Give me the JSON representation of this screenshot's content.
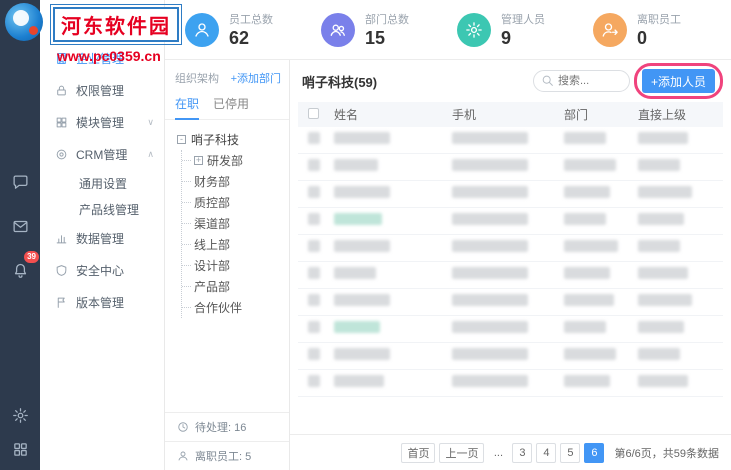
{
  "watermark": {
    "site_name": "河东软件园",
    "site_url": "www.pc0359.cn"
  },
  "rail": {
    "notification_badge": "39"
  },
  "header": {
    "stats": [
      {
        "label": "员工总数",
        "value": "62",
        "color": "#3da2f0",
        "icon": "employees-icon"
      },
      {
        "label": "部门总数",
        "value": "15",
        "color": "#7a80ea",
        "icon": "departments-icon"
      },
      {
        "label": "管理人员",
        "value": "9",
        "color": "#3cc7b2",
        "icon": "managers-icon"
      },
      {
        "label": "离职员工",
        "value": "0",
        "color": "#f5a860",
        "icon": "departed-icon"
      }
    ]
  },
  "menu": {
    "items": [
      {
        "label": "企业管理",
        "icon": "building-icon",
        "active": true
      },
      {
        "label": "权限管理",
        "icon": "permission-icon"
      },
      {
        "label": "模块管理",
        "icon": "modules-icon",
        "chevron": "down"
      },
      {
        "label": "CRM管理",
        "icon": "crm-icon",
        "chevron": "up"
      },
      {
        "label": "通用设置",
        "sub": true
      },
      {
        "label": "产品线管理",
        "sub": true
      },
      {
        "label": "数据管理",
        "icon": "data-icon"
      },
      {
        "label": "安全中心",
        "icon": "security-icon"
      },
      {
        "label": "版本管理",
        "icon": "version-icon"
      }
    ]
  },
  "org": {
    "title": "组织架构",
    "add_department": "+添加部门",
    "tabs": [
      {
        "label": "在职",
        "active": true
      },
      {
        "label": "已停用",
        "active": false
      }
    ],
    "tree_root": "哨子科技",
    "tree_children": [
      {
        "label": "研发部",
        "expandable": true
      },
      {
        "label": "财务部"
      },
      {
        "label": "质控部"
      },
      {
        "label": "渠道部"
      },
      {
        "label": "线上部"
      },
      {
        "label": "设计部"
      },
      {
        "label": "产品部"
      },
      {
        "label": "合作伙伴"
      }
    ],
    "pending": "待处理: 16",
    "resigned": "离职员工: 5"
  },
  "main": {
    "title": "哨子科技(59)",
    "search_placeholder": "搜索...",
    "add_member": "+添加人员",
    "table": {
      "columns": [
        "姓名",
        "手机",
        "部门",
        "直接上级"
      ],
      "rows_blurred": true,
      "rows": [
        {
          "name": 56,
          "phone": 76,
          "dept": 42,
          "sup": 50
        },
        {
          "name": 44,
          "phone": 76,
          "dept": 52,
          "sup": 42
        },
        {
          "name": 56,
          "phone": 76,
          "dept": 46,
          "sup": 54
        },
        {
          "name": 48,
          "phone": 76,
          "dept": 42,
          "sup": 46,
          "tint": true
        },
        {
          "name": 56,
          "phone": 76,
          "dept": 54,
          "sup": 42
        },
        {
          "name": 42,
          "phone": 76,
          "dept": 46,
          "sup": 50
        },
        {
          "name": 56,
          "phone": 76,
          "dept": 50,
          "sup": 54
        },
        {
          "name": 46,
          "phone": 76,
          "dept": 42,
          "sup": 46,
          "tint": true
        },
        {
          "name": 56,
          "phone": 76,
          "dept": 52,
          "sup": 42
        },
        {
          "name": 50,
          "phone": 76,
          "dept": 46,
          "sup": 50
        }
      ]
    },
    "pagination": {
      "buttons": [
        "首页",
        "上一页",
        "...",
        "3",
        "4",
        "5",
        "6"
      ],
      "active": "6",
      "summary": "第6/6页，共59条数据"
    }
  }
}
